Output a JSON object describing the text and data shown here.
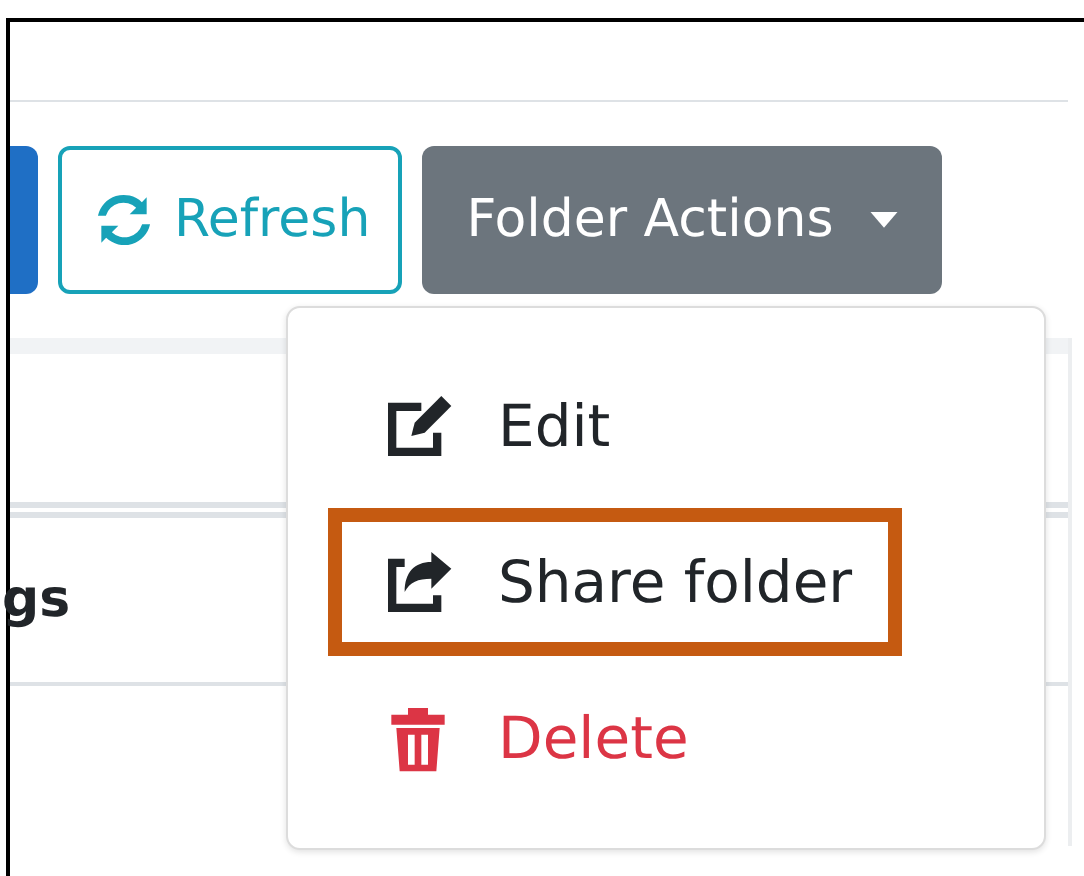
{
  "toolbar": {
    "buttons": [
      {
        "label": "Refresh",
        "kind": "outline"
      },
      {
        "label": "Folder Actions",
        "kind": "dropdown"
      }
    ]
  },
  "table": {
    "header_cell": "gs"
  },
  "menu": {
    "items": [
      {
        "label": "Edit",
        "kind": "normal",
        "highlighted": false
      },
      {
        "label": "Share folder",
        "kind": "normal",
        "highlighted": true
      },
      {
        "label": "Delete",
        "kind": "danger",
        "highlighted": false
      }
    ]
  }
}
